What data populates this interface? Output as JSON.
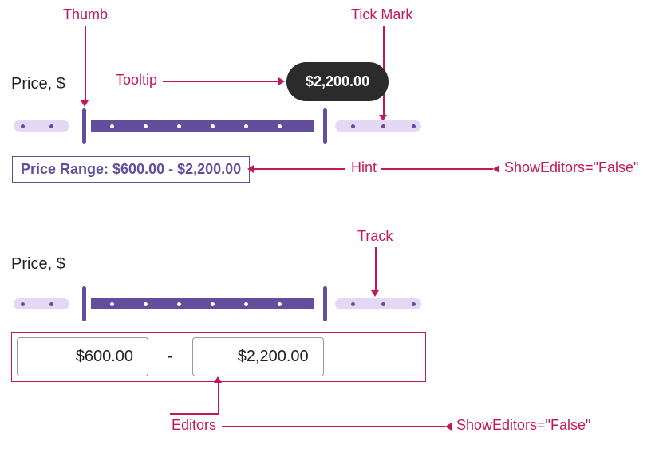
{
  "callouts": {
    "thumb": "Thumb",
    "tooltip": "Tooltip",
    "tick_mark": "Tick Mark",
    "hint": "Hint",
    "show_editors_false_1": "ShowEditors=\"False\"",
    "track": "Track",
    "editors": "Editors",
    "show_editors_false_2": "ShowEditors=\"False\""
  },
  "slider1": {
    "label": "Price, $",
    "tooltip_value": "$2,200.00",
    "hint_text": "Price Range: $600.00 - $2,200.00"
  },
  "slider2": {
    "label": "Price, $",
    "editor_min": "$600.00",
    "editor_max": "$2,200.00",
    "editor_sep": "-"
  }
}
